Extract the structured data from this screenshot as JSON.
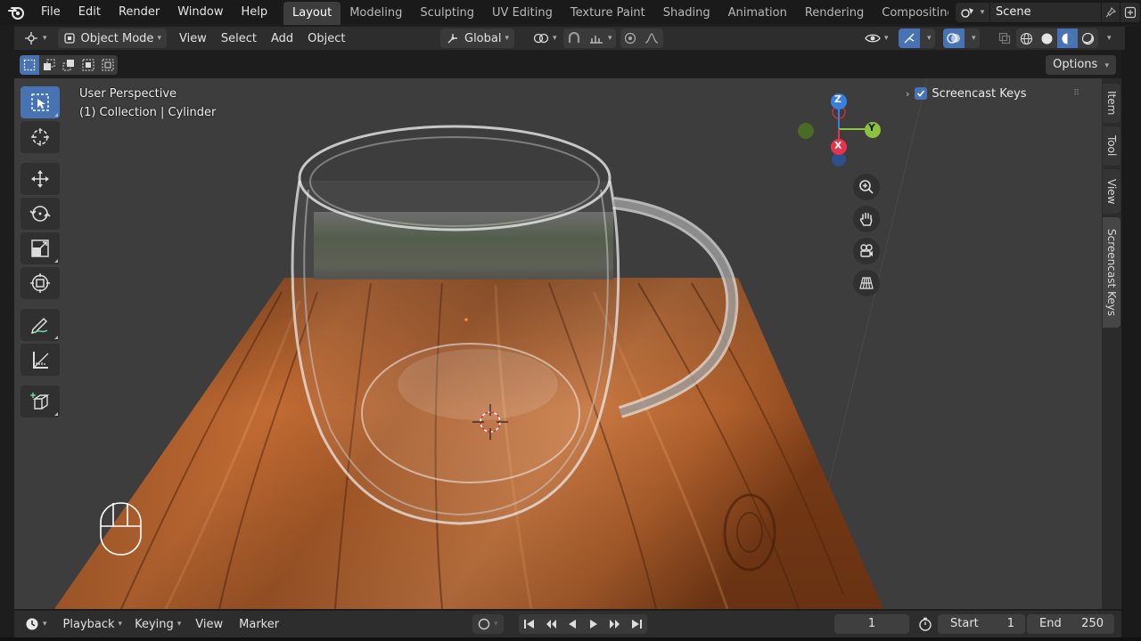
{
  "menu": {
    "items": [
      "File",
      "Edit",
      "Render",
      "Window",
      "Help"
    ]
  },
  "workspaces": {
    "tabs": [
      "Layout",
      "Modeling",
      "Sculpting",
      "UV Editing",
      "Texture Paint",
      "Shading",
      "Animation",
      "Rendering",
      "Compositing"
    ],
    "active": "Layout"
  },
  "scene": {
    "name": "Scene"
  },
  "viewport_header": {
    "mode": "Object Mode",
    "menus": [
      "View",
      "Select",
      "Add",
      "Object"
    ],
    "transform_orientation": "Global"
  },
  "tool_settings": {
    "options_label": "Options"
  },
  "viewport": {
    "view_name": "User Perspective",
    "collection_info": "(1) Collection | Cylinder",
    "gizmo_axes": {
      "x": "X",
      "y": "Y",
      "z": "Z"
    }
  },
  "screencast": {
    "label": "Screencast Keys",
    "checked": true
  },
  "sidebar_tabs": [
    "Item",
    "Tool",
    "View",
    "Screencast Keys"
  ],
  "timeline": {
    "menus": [
      "Playback",
      "Keying",
      "View",
      "Marker"
    ],
    "current_frame": "1",
    "start_label": "Start",
    "start_value": "1",
    "end_label": "End",
    "end_value": "250"
  },
  "colors": {
    "accent": "#4772b3",
    "axis_x": "#e8324b",
    "axis_y": "#8cc33c",
    "axis_z": "#3a7fe0"
  }
}
